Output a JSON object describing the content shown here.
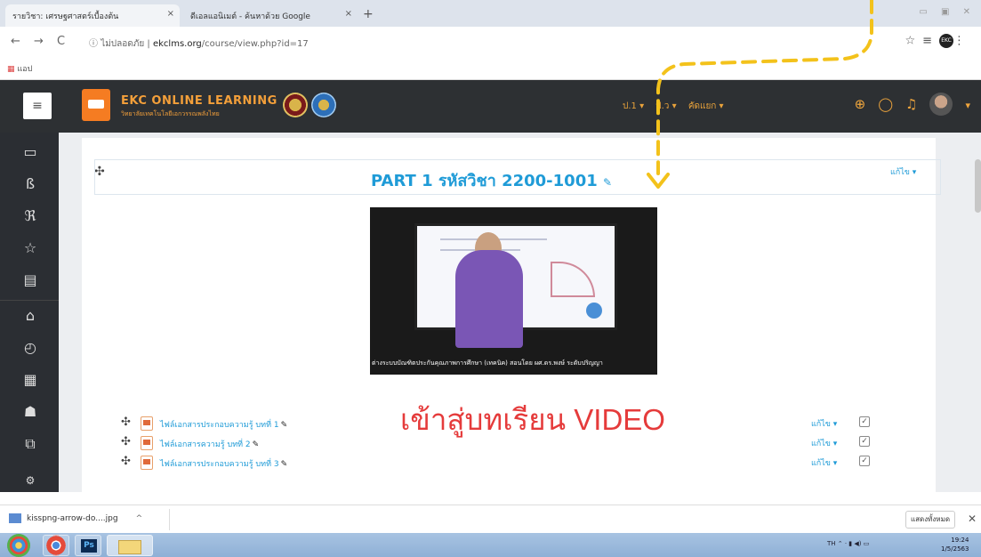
{
  "browser": {
    "tabs": [
      {
        "title": "รายวิชา: เศรษฐศาสตร์เบื้องต้น",
        "close": "×"
      },
      {
        "title": "ดีเอลแอนิเมต์ - ค้นหาด้วย Google",
        "close": "×"
      }
    ],
    "new_tab": "+",
    "nav": {
      "back": "←",
      "forward": "→",
      "reload": "C"
    },
    "url_prefix": "ไม่ปลอดภัย",
    "url_host": "ekclms.org",
    "url_path": "/course/view.php?id=17",
    "account": "EKC",
    "bookmarks_label": "แอป",
    "window_controls": "▭ ▣ ✕"
  },
  "site": {
    "brand": "EKC ONLINE LEARNING",
    "brand_sub": "วิทยาลัยเทคโนโลยีเอกวรรณพลังไทย",
    "menu": [
      {
        "label": "ป.1 ▾"
      },
      {
        "label": "ป.ว ▾"
      },
      {
        "label": "คัดแยก ▾"
      }
    ]
  },
  "section": {
    "title": "PART 1 รหัสวิชา 2200-1001",
    "edit_label": "แก้ไข ▾",
    "video_caption": "ต่างระบบบัณฑิตประกันคุณภาพการศึกษา (เทคนิค) สอนโดย ผศ.ดร.พงษ์ ระดับปริญญา",
    "enter_label": "เข้าสู่บทเรียน VIDEO"
  },
  "resources": [
    {
      "label": "ไฟล์เอกสารประกอบความรู้ บทที่ 1",
      "edit": "แก้ไข ▾",
      "check": "✓"
    },
    {
      "label": "ไฟล์เอกสารความรู้ บทที่ 2",
      "edit": "แก้ไข ▾",
      "check": "✓"
    },
    {
      "label": "ไฟล์เอกสารประกอบความรู้ บทที่ 3",
      "edit": "แก้ไข ▾",
      "check": "✓"
    }
  ],
  "download": {
    "file": "kisspng-arrow-do....jpg",
    "chevron": "^",
    "show_all": "แสดงทั้งหมด",
    "close": "✕"
  },
  "taskbar": {
    "tray": "TH ⌃ · ▮ ◀) ▭",
    "time": "19:24",
    "date": "1/5/2563"
  },
  "colors": {
    "accent_blue": "#1f9bd7",
    "brand_orange": "#f57c22",
    "header_dark": "#2d3033",
    "arrow_yellow": "#f3c21b",
    "enter_red": "#e53b3b"
  }
}
